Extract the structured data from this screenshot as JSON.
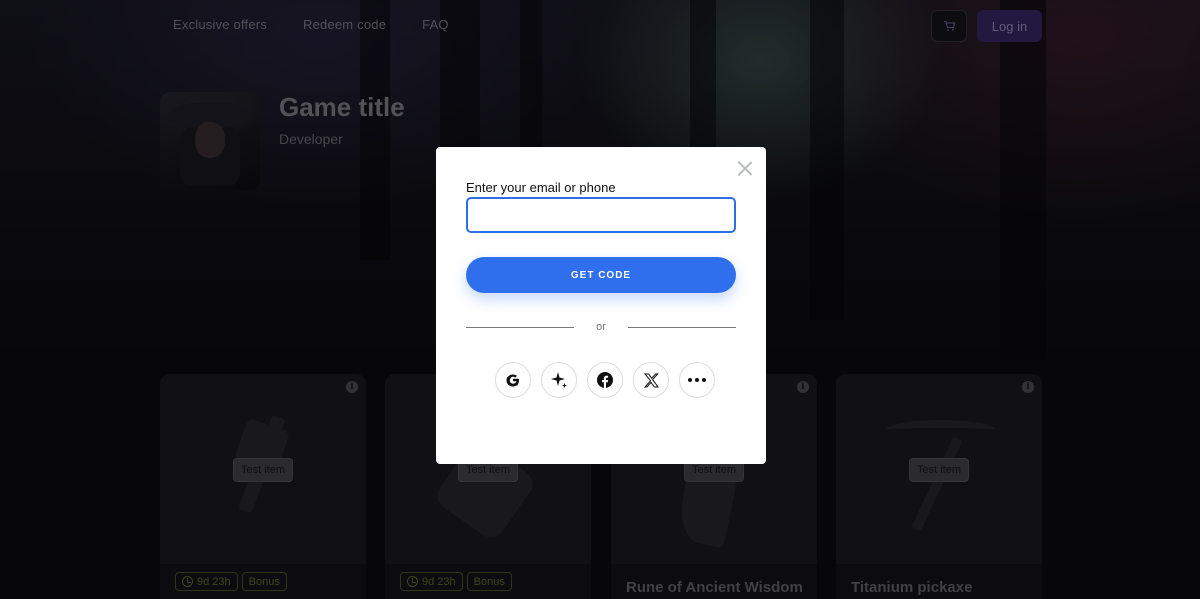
{
  "nav": {
    "items": [
      {
        "label": "Exclusive offers"
      },
      {
        "label": "Redeem code"
      },
      {
        "label": "FAQ"
      }
    ],
    "cart_icon": "cart-icon",
    "login_label": "Log in"
  },
  "game": {
    "title": "Game title",
    "developer": "Developer"
  },
  "cards": [
    {
      "badge": "Test item",
      "timer": "9d 23h",
      "bonus": "Bonus",
      "name": ""
    },
    {
      "badge": "Test item",
      "timer": "9d 23h",
      "bonus": "Bonus",
      "name": ""
    },
    {
      "badge": "Test item",
      "timer": "",
      "bonus": "",
      "name": "Rune of Ancient Wisdom"
    },
    {
      "badge": "Test item",
      "timer": "",
      "bonus": "",
      "name": "Titanium pickaxe"
    }
  ],
  "modal": {
    "field_label": "Enter your email or phone",
    "field_value": "",
    "field_placeholder": "",
    "submit_label": "GET CODE",
    "divider_text": "or",
    "social_buttons": [
      "google-icon",
      "sparkle-icon",
      "facebook-icon",
      "x-icon",
      "more-icon"
    ]
  },
  "colors": {
    "accent": "#2f6fee",
    "login_bg": "#3b2a6e",
    "tag_border": "#56592a"
  }
}
